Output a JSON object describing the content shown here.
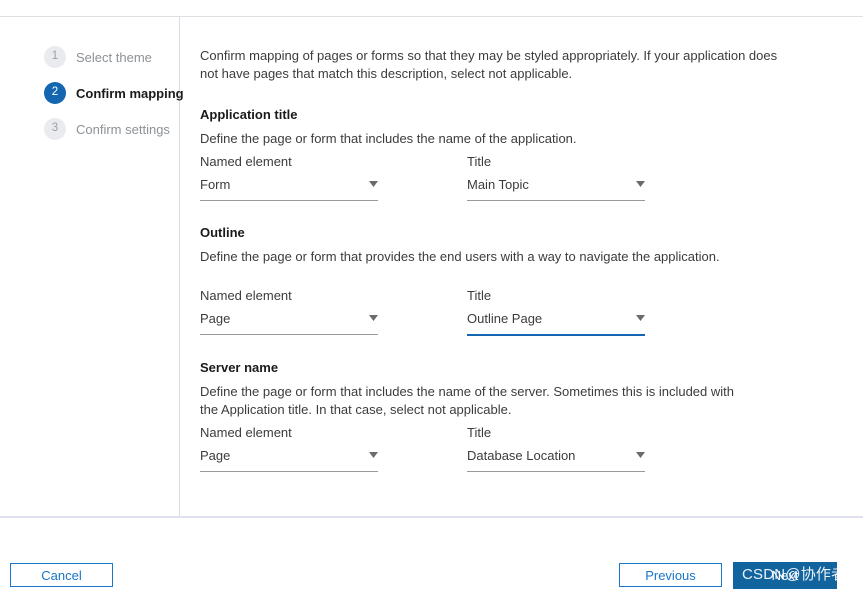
{
  "steps": [
    {
      "number": "1",
      "label": "Select theme",
      "active": false
    },
    {
      "number": "2",
      "label": "Confirm mapping",
      "active": true
    },
    {
      "number": "3",
      "label": "Confirm settings",
      "active": false
    }
  ],
  "content": {
    "intro": "Confirm mapping of pages or forms so that they may be styled appropriately. If your application does not have pages that match this description, select not applicable.",
    "sections": [
      {
        "title": "Application title",
        "description": "Define the page or form that includes the name of the application.",
        "named_element": {
          "label": "Named element",
          "value": "Form",
          "focused": false
        },
        "title_field": {
          "label": "Title",
          "value": "Main Topic",
          "focused": false
        }
      },
      {
        "title": "Outline",
        "description": "Define the page or form that provides the end users with a way to navigate the application.",
        "named_element": {
          "label": "Named element",
          "value": "Page",
          "focused": false
        },
        "title_field": {
          "label": "Title",
          "value": "Outline Page",
          "focused": true
        }
      },
      {
        "title": "Server name",
        "description": "Define the page or form that includes the name of the server. Sometimes this is included with the Application title.  In that case, select not applicable.",
        "named_element": {
          "label": "Named element",
          "value": "Page",
          "focused": false
        },
        "title_field": {
          "label": "Title",
          "value": "Database Location",
          "focused": false
        }
      }
    ]
  },
  "footer": {
    "cancel": "Cancel",
    "previous": "Previous",
    "next": "Next"
  },
  "watermark": {
    "text": "CSDN@协作者"
  },
  "colors": {
    "accent_blue": "#1466b0",
    "button_blue": "#12649f",
    "border_blue": "#1a76c8",
    "step_inactive_bg": "#e9ebee",
    "divider": "#d9dde6"
  }
}
